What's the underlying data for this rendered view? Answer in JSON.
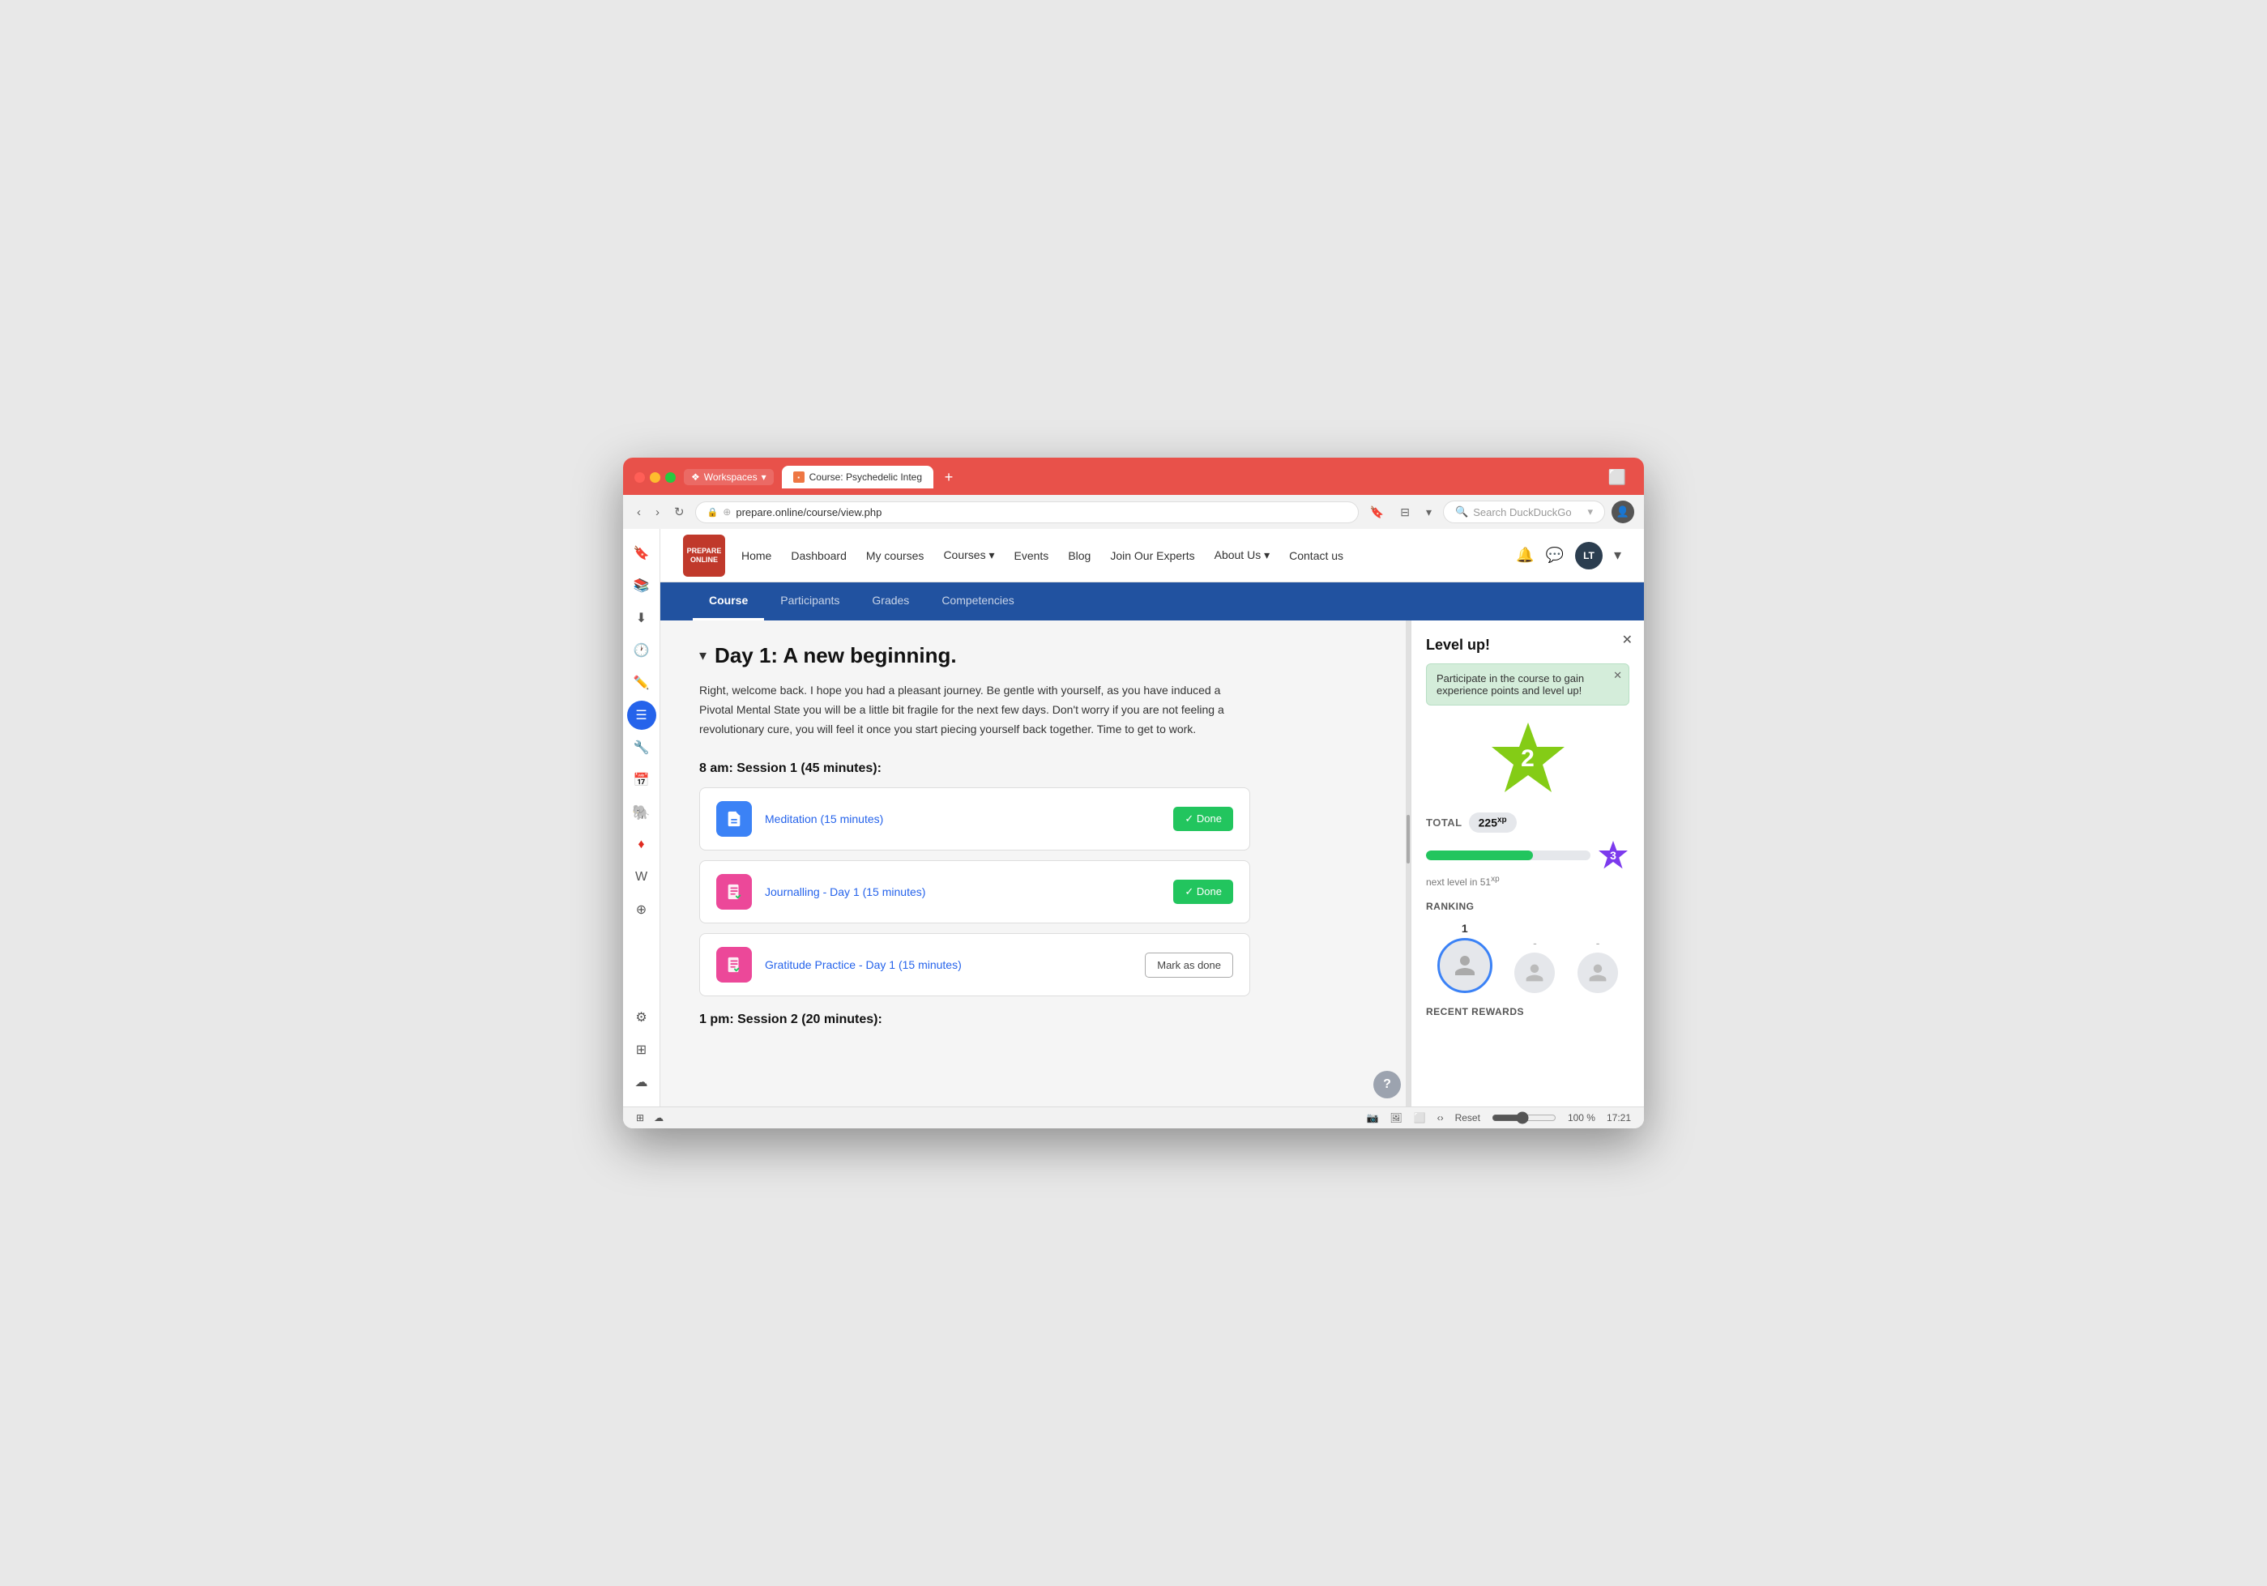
{
  "browser": {
    "workspace_label": "Workspaces",
    "tab_title": "Course: Psychedelic Integ",
    "url": "prepare.online/course/view.php",
    "search_placeholder": "Search DuckDuckGo",
    "new_tab_icon": "+"
  },
  "nav": {
    "logo_text": "PREPARE\nONLINE",
    "links": [
      "Home",
      "Dashboard",
      "My courses",
      "Courses",
      "Events",
      "Blog",
      "Join Our Experts",
      "About Us",
      "Contact us"
    ],
    "user_initials": "LT"
  },
  "course_tabs": {
    "tabs": [
      "Course",
      "Participants",
      "Grades",
      "Competencies"
    ],
    "active": 0
  },
  "course": {
    "day_title": "Day 1: A new beginning.",
    "description": "Right, welcome back. I hope you had a pleasant journey. Be gentle with yourself, as you have induced a Pivotal Mental State you will be a little bit fragile for the next few days. Don't worry if you are not feeling a revolutionary cure, you will feel it once you start piecing yourself back together. Time to get to work.",
    "session1_label": "8 am: Session 1 (45 minutes):",
    "session2_label": "1 pm: Session 2 (20 minutes):",
    "activities": [
      {
        "title": "Meditation (15 minutes)",
        "icon_type": "blue",
        "status": "done",
        "btn_label": "✓ Done"
      },
      {
        "title": "Journalling - Day 1 (15 minutes)",
        "icon_type": "pink",
        "status": "done",
        "btn_label": "✓ Done"
      },
      {
        "title": "Gratitude Practice - Day 1 (15 minutes)",
        "icon_type": "pink",
        "status": "pending",
        "btn_label": "Mark as done"
      }
    ]
  },
  "level_panel": {
    "title": "Level up!",
    "tooltip_text": "Participate in the course to gain experience points and level up!",
    "current_level": "2",
    "next_level_star": "3",
    "total_label": "TOTAL",
    "xp_value": "225",
    "xp_suffix": "xp",
    "next_level_text": "next level in 51",
    "next_level_xp": "xp",
    "progress_pct": 65,
    "ranking_label": "RANKING",
    "rank1": "1",
    "rank2": "-",
    "rank3": "-",
    "recent_rewards_label": "RECENT REWARDS"
  },
  "status_bar": {
    "reset_label": "Reset",
    "zoom_value": "100 %",
    "time": "17:21"
  }
}
